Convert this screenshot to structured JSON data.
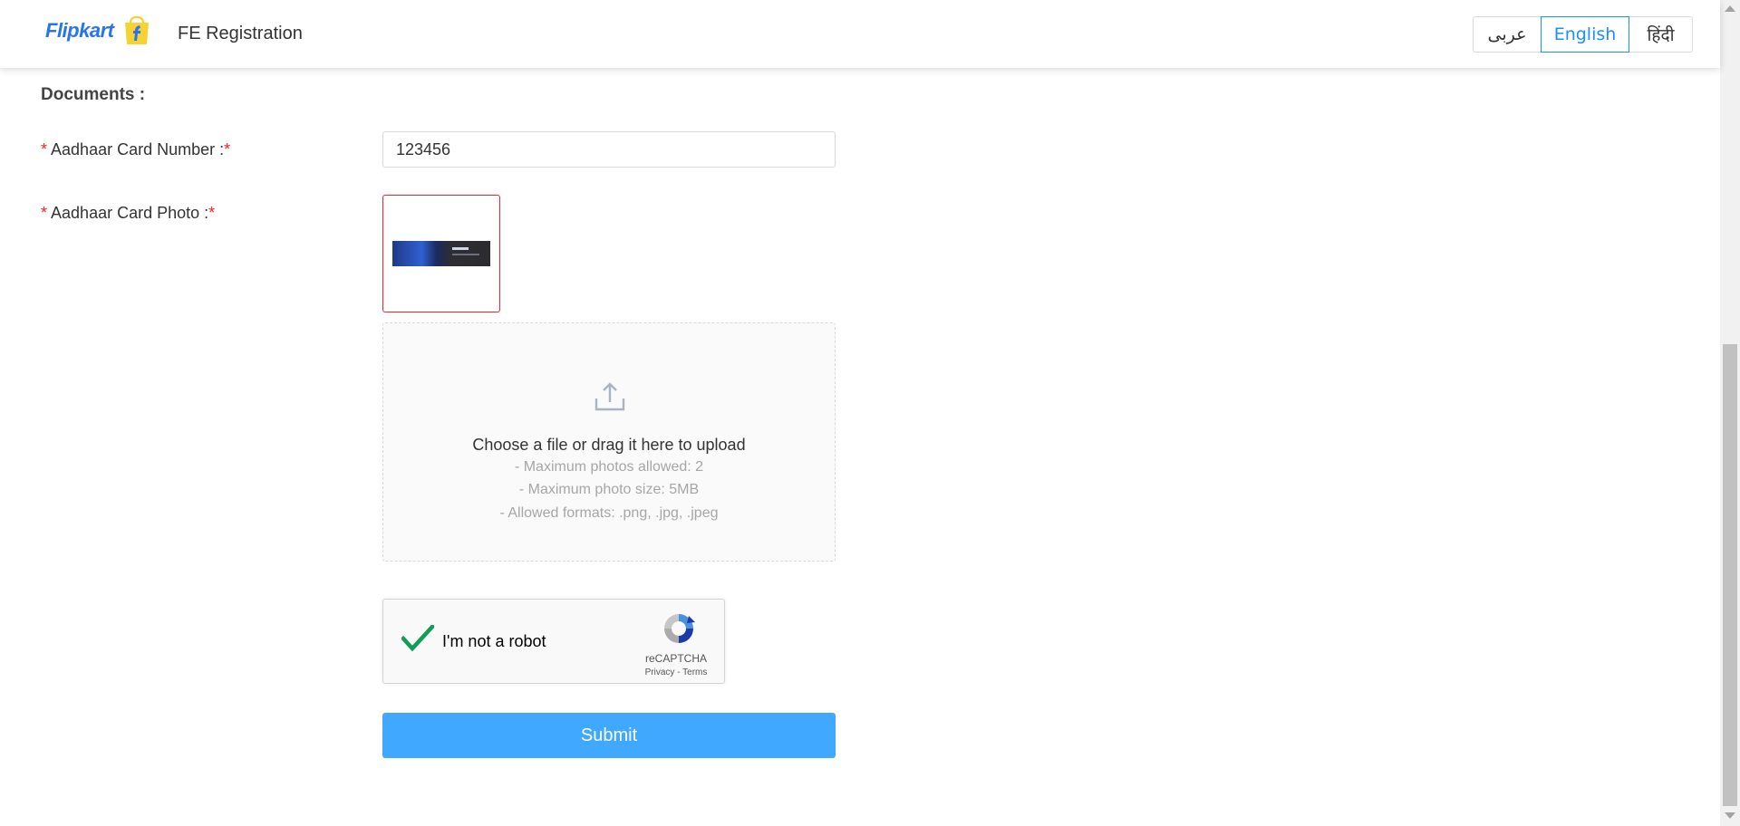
{
  "header": {
    "logo_text": "Flipkart",
    "title": "FE Registration",
    "languages": [
      {
        "label": "عربى",
        "active": false
      },
      {
        "label": "English",
        "active": true
      },
      {
        "label": "हिंदी",
        "active": false
      }
    ]
  },
  "form": {
    "section_title": "Documents :",
    "required_mark": "*",
    "aadhaar_number": {
      "label": "Aadhaar Card Number :",
      "value": "123456"
    },
    "aadhaar_photo": {
      "label": "Aadhaar Card Photo :"
    },
    "upload": {
      "main_text": "Choose a file or drag it here to upload",
      "hints": [
        "- Maximum photos allowed: 2",
        "- Maximum photo size: 5MB",
        "- Allowed formats: .png, .jpg, .jpeg"
      ],
      "icon": "upload-icon"
    },
    "captcha": {
      "label": "I'm not a robot",
      "checked": true,
      "brand": "reCAPTCHA",
      "links": "Privacy - Terms"
    },
    "submit_label": "Submit"
  },
  "colors": {
    "brand_blue": "#2874f0",
    "accent_blue": "#1890ff",
    "submit_blue": "#40a9ff",
    "required_red": "#f5222d",
    "check_green": "#0f9d58"
  }
}
